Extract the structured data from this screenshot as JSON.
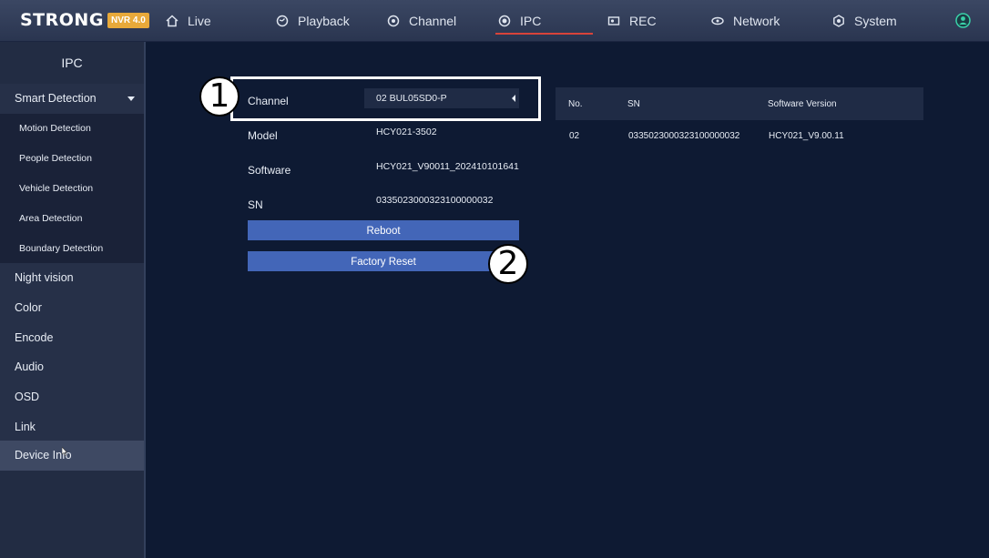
{
  "brand": {
    "name": "STRONG",
    "badge": "NVR 4.0"
  },
  "nav": [
    {
      "label": "Live",
      "icon": "home-icon"
    },
    {
      "label": "Playback",
      "icon": "playback-icon"
    },
    {
      "label": "Channel",
      "icon": "channel-icon"
    },
    {
      "label": "IPC",
      "icon": "ipc-camera-icon"
    },
    {
      "label": "REC",
      "icon": "rec-icon"
    },
    {
      "label": "Network",
      "icon": "network-icon"
    },
    {
      "label": "System",
      "icon": "system-icon"
    }
  ],
  "active_nav": "IPC",
  "colors": {
    "accent_line": "#d8433a",
    "button": "#4366b8",
    "badge": "#e8a93a",
    "background": "#0e1a33"
  },
  "sidebar": {
    "title": "IPC",
    "items": [
      {
        "label": "Smart  Detection",
        "type": "main",
        "expanded": true
      },
      {
        "label": "Motion  Detection",
        "type": "sub"
      },
      {
        "label": "People  Detection",
        "type": "sub"
      },
      {
        "label": "Vehicle  Detection",
        "type": "sub"
      },
      {
        "label": "Area  Detection",
        "type": "sub"
      },
      {
        "label": "Boundary  Detection",
        "type": "sub"
      },
      {
        "label": "Night  vision",
        "type": "main"
      },
      {
        "label": "Color",
        "type": "main"
      },
      {
        "label": "Encode",
        "type": "main"
      },
      {
        "label": "Audio",
        "type": "main"
      },
      {
        "label": "OSD",
        "type": "main"
      },
      {
        "label": "Link",
        "type": "main"
      },
      {
        "label": "Device  Info",
        "type": "main",
        "active": true
      }
    ]
  },
  "device_info": {
    "channel_label": "Channel",
    "channel_value": "02  BUL05SD0-P",
    "model_label": "Model",
    "model_value": "HCY021-3502",
    "software_label": "Software",
    "software_value": "HCY021_V90011_202410101641",
    "sn_label": "SN",
    "sn_value": "0335023000323100000032",
    "reboot_label": "Reboot",
    "factory_reset_label": "Factory  Reset"
  },
  "callouts": {
    "one": "1",
    "two": "2"
  },
  "table": {
    "headers": [
      "No.",
      "SN",
      "Software Version"
    ],
    "rows": [
      [
        "02",
        "0335023000323100000032",
        "HCY021_V9.00.11"
      ]
    ]
  }
}
